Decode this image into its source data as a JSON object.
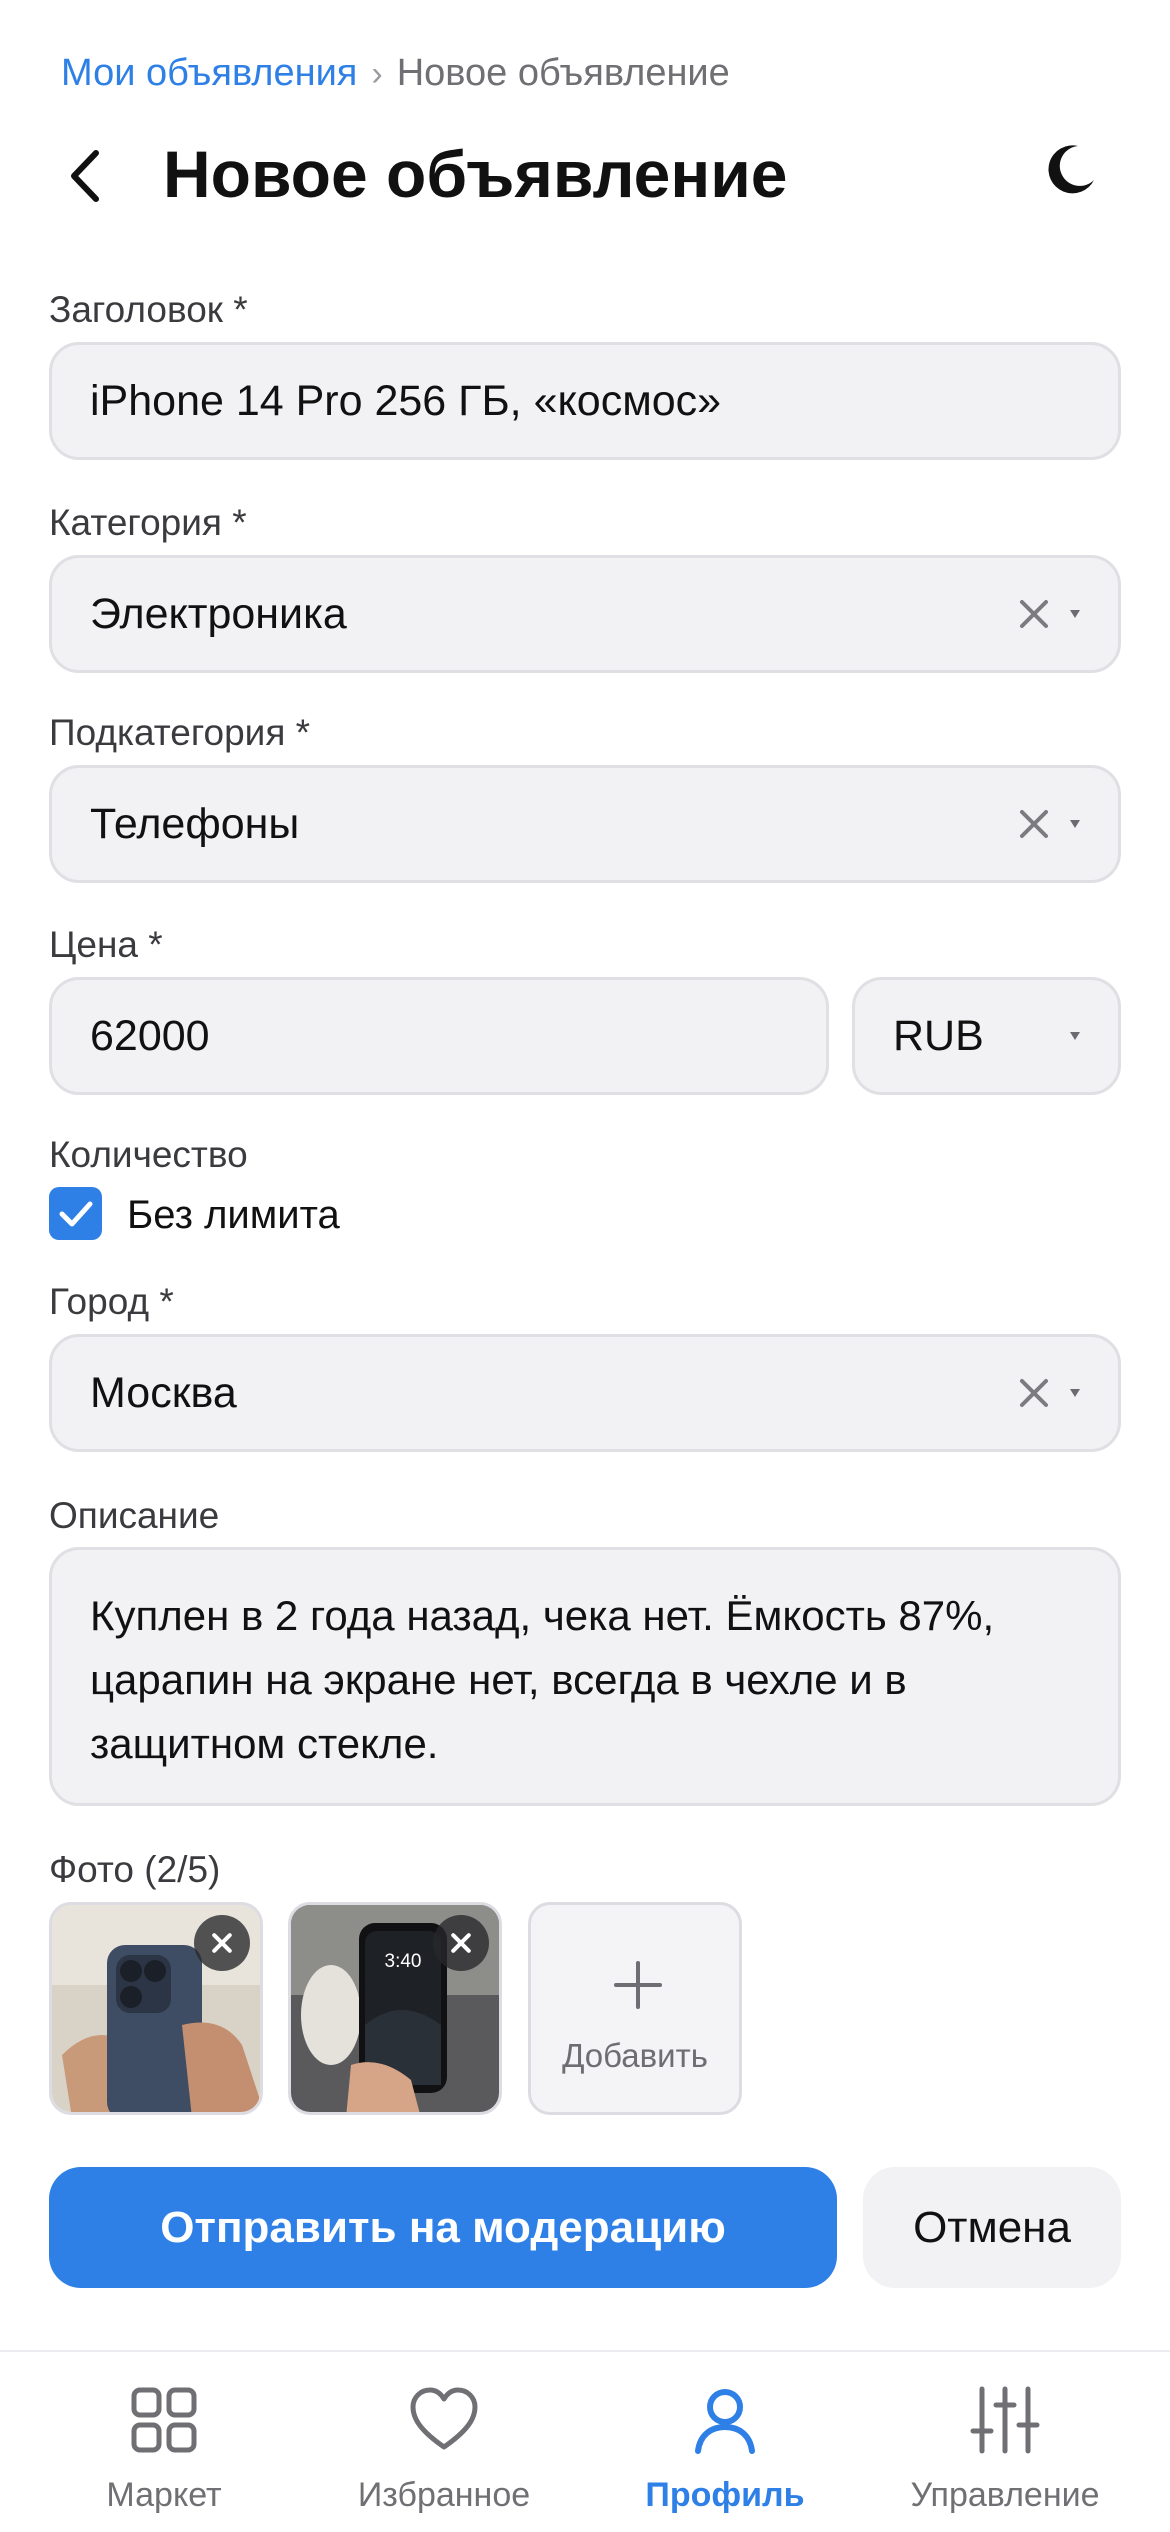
{
  "breadcrumb": {
    "parent": "Мои объявления",
    "separator": "›",
    "current": "Новое объявление"
  },
  "header": {
    "title": "Новое объявление"
  },
  "form": {
    "title_field": {
      "label": "Заголовок *",
      "value": "iPhone 14 Pro 256 ГБ, «космос»"
    },
    "category": {
      "label": "Категория *",
      "value": "Электроника"
    },
    "subcategory": {
      "label": "Подкатегория *",
      "value": "Телефоны"
    },
    "price": {
      "label": "Цена *",
      "value": "62000",
      "currency": "RUB"
    },
    "quantity": {
      "label": "Количество",
      "unlimited_label": "Без лимита",
      "unlimited_checked": true
    },
    "city": {
      "label": "Город *",
      "value": "Москва"
    },
    "description": {
      "label": "Описание",
      "value": "Куплен в 2 года назад, чека нет. Ёмкость 87%, царапин на экране нет, всегда в чехле и в защитном стекле."
    },
    "photos": {
      "label": "Фото (2/5)",
      "add_label": "Добавить",
      "count": 2,
      "max": 5
    }
  },
  "actions": {
    "submit": "Отправить на модерацию",
    "cancel": "Отмена"
  },
  "tabbar": {
    "tabs": [
      {
        "label": "Маркет",
        "icon": "grid-icon"
      },
      {
        "label": "Избранное",
        "icon": "heart-icon"
      },
      {
        "label": "Профиль",
        "icon": "user-icon",
        "active": true
      },
      {
        "label": "Управление",
        "icon": "sliders-icon"
      }
    ]
  },
  "colors": {
    "accent": "#2f80e6",
    "field_bg": "#f2f2f5",
    "field_border": "#dfdfe4",
    "muted_text": "#6f6f74"
  }
}
